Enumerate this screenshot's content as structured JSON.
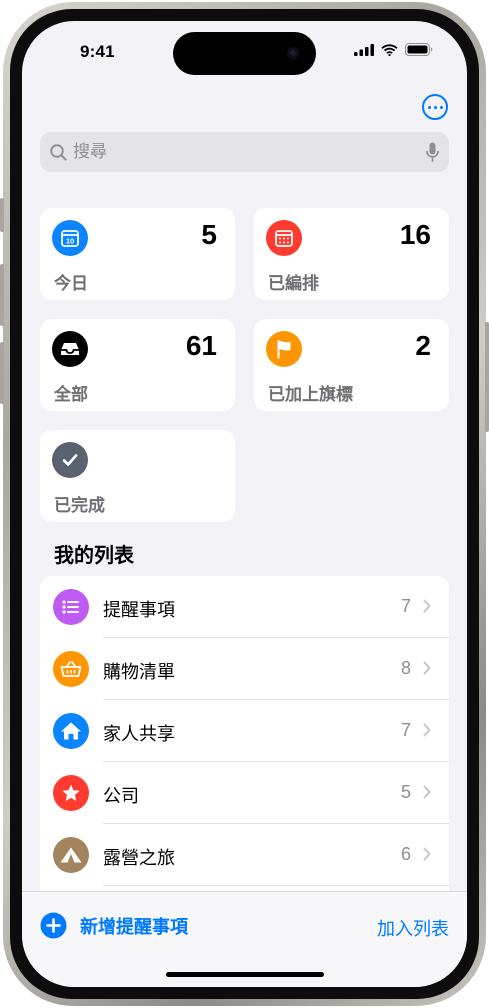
{
  "status_bar": {
    "time": "9:41"
  },
  "search": {
    "placeholder": "搜尋"
  },
  "smart_lists": [
    {
      "label": "今日",
      "count": "5",
      "icon": "calendar-today-icon",
      "color": "#0a84ff",
      "badge": "10"
    },
    {
      "label": "已編排",
      "count": "16",
      "icon": "calendar-grid-icon",
      "color": "#ff3b30"
    },
    {
      "label": "全部",
      "count": "61",
      "icon": "tray-icon",
      "color": "#000000"
    },
    {
      "label": "已加上旗標",
      "count": "2",
      "icon": "flag-icon",
      "color": "#ff9500"
    },
    {
      "label": "已完成",
      "count": "",
      "icon": "checkmark-icon",
      "color": "#5a6270"
    }
  ],
  "my_lists": {
    "title": "我的列表",
    "items": [
      {
        "label": "提醒事項",
        "count": "7",
        "icon": "bullet-list-icon",
        "color": "#bf5af2"
      },
      {
        "label": "購物清單",
        "count": "8",
        "icon": "basket-icon",
        "color": "#ff9500"
      },
      {
        "label": "家人共享",
        "count": "7",
        "icon": "house-icon",
        "color": "#0a84ff"
      },
      {
        "label": "公司",
        "count": "5",
        "icon": "star-icon",
        "color": "#ff3b30"
      },
      {
        "label": "露營之旅",
        "count": "6",
        "icon": "tent-icon",
        "color": "#a2845e"
      }
    ]
  },
  "toolbar": {
    "new_reminder_label": "新增提醒事項",
    "add_list_label": "加入列表"
  },
  "colors": {
    "accent": "#007aff",
    "background": "#f2f2f7"
  }
}
